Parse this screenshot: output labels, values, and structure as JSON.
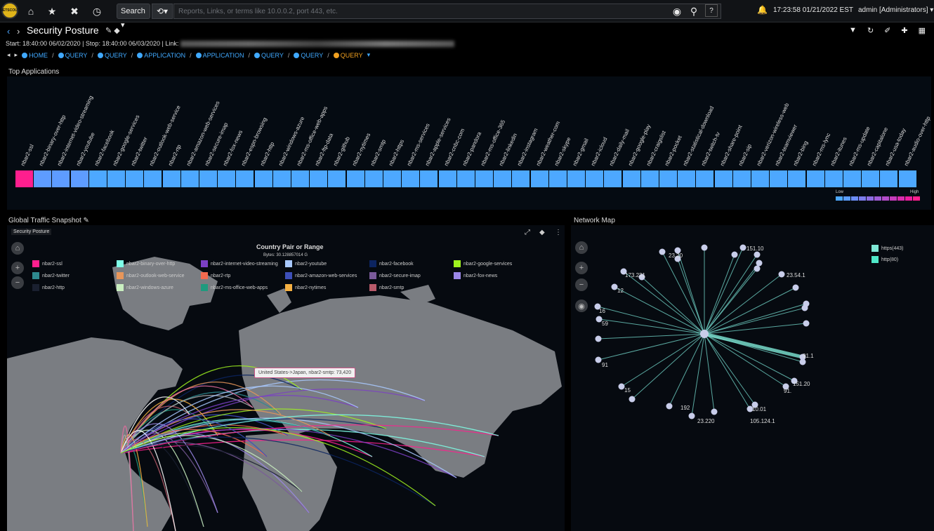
{
  "toolbar": {
    "logo_text": "NETSCOUT",
    "search_btn": "Search ▾",
    "history_btn": "⟲▾",
    "search_placeholder": "Reports, Links, or terms like 10.0.0.2, port 443, etc.",
    "clock": "17:23:58 01/21/2022 EST",
    "user": "admin [Administrators] ▾"
  },
  "header": {
    "title": "Security Posture",
    "timeline": "Start: 18:40:00 06/02/2020 | Stop: 18:40:00 06/03/2020 | Link:",
    "breadcrumbs": [
      "HOME",
      "QUERY",
      "QUERY",
      "APPLICATION",
      "APPLICATION",
      "QUERY",
      "QUERY",
      "QUERY"
    ]
  },
  "top_apps": {
    "label": "Top Applications",
    "apps": [
      "nbar2-ssl",
      "nbar2-binary-over-http",
      "nbar2-internet-video-streaming",
      "nbar2-youtube",
      "nbar2-facebook",
      "nbar2-google-services",
      "nbar2-twitter",
      "nbar2-outlook-web-service",
      "nbar2-rtp",
      "nbar2-amazon-web-services",
      "nbar2-secure-imap",
      "nbar2-fox-news",
      "nbar2-espn-browsing",
      "nbar2-http",
      "nbar2-windows-azure",
      "nbar2-ms-office-web-apps",
      "nbar2-ftp-data",
      "nbar2-github",
      "nbar2-nytimes",
      "nbar2-smtp",
      "nbar2-https",
      "nbar2-ms-services",
      "nbar2-apple-services",
      "nbar2-cnbc-com",
      "nbar2-pandora",
      "nbar2-ms-office-365",
      "nbar2-linkedin",
      "nbar2-instagram",
      "nbar2-weather-com",
      "nbar2-skype",
      "nbar2-gmail",
      "nbar2-icloud",
      "nbar2-daily-mail",
      "nbar2-google-play",
      "nbar2-craigslist",
      "nbar2-pocket",
      "nbar2-statistical-download",
      "nbar2-twitch-tv",
      "nbar2-share-point",
      "nbar2-sip",
      "nbar2-verizon-wireless-web",
      "nbar2-teamviewer",
      "nbar2-bing",
      "nbar2-ms-lync",
      "nbar2-itunes",
      "nbar2-ms-update",
      "nbar2-capitalone",
      "nbar2-usa-today",
      "nbar2-audio-over-http"
    ],
    "cell_colors": [
      "#ff1f8e",
      "#5e9cff",
      "#5e9cff",
      "#5e9cff"
    ],
    "default_color": "#4da8ff",
    "legend_low": "Low",
    "legend_high": "High",
    "scale_colors": [
      "#4da8ff",
      "#5a9cff",
      "#6b8cf5",
      "#7c7ceb",
      "#8d6ce1",
      "#a05cd6",
      "#b34cc9",
      "#c63cbb",
      "#d92cad",
      "#ec1c9e",
      "#ff1f8e"
    ]
  },
  "global_traffic": {
    "label": "Global Traffic Snapshot",
    "sub_label": "Security Posture",
    "chart_title": "Country Pair or Range",
    "bytes": "Bytes: 30.128857014 G",
    "tooltip": "United States->Japan, nbar2-smtp: 73,420",
    "legend": [
      {
        "name": "nbar2-ssl",
        "color": "#ff1f8e"
      },
      {
        "name": "nbar2-binary-over-http",
        "color": "#7fffe8"
      },
      {
        "name": "nbar2-internet-video-streaming",
        "color": "#7b3fc4"
      },
      {
        "name": "nbar2-youtube",
        "color": "#a9c9ff"
      },
      {
        "name": "nbar2-facebook",
        "color": "#0c2460"
      },
      {
        "name": "nbar2-google-services",
        "color": "#9ff21e"
      },
      {
        "name": "nbar2-twitter",
        "color": "#2e8a8f"
      },
      {
        "name": "nbar2-outlook-web-service",
        "color": "#e8965a"
      },
      {
        "name": "nbar2-rtp",
        "color": "#f26a4f"
      },
      {
        "name": "nbar2-amazon-web-services",
        "color": "#3d4fb8"
      },
      {
        "name": "nbar2-secure-imap",
        "color": "#7a5a9a"
      },
      {
        "name": "nbar2-fox-news",
        "color": "#9b87e8"
      },
      {
        "name": "nbar2-http",
        "color": "#1a2030"
      },
      {
        "name": "nbar2-windows-azure",
        "color": "#c9efc0"
      },
      {
        "name": "nbar2-ms-office-web-apps",
        "color": "#1f9a7e"
      },
      {
        "name": "nbar2-nytimes",
        "color": "#f5b042"
      },
      {
        "name": "nbar2-smtp",
        "color": "#b85a6a"
      }
    ]
  },
  "network_map": {
    "label": "Network Map",
    "legend": [
      {
        "name": "https(443)",
        "color": "#7fe8d6"
      },
      {
        "name": "http(80)",
        "color": "#4fe8c8"
      }
    ],
    "node_labels": [
      "151.10",
      "23.20",
      "173.231",
      "23.54.1",
      "12",
      "16",
      "59",
      "91",
      "15",
      "91.",
      "151.20",
      "91.1",
      "192",
      "10.01",
      "23.220",
      "105.124.1"
    ]
  }
}
